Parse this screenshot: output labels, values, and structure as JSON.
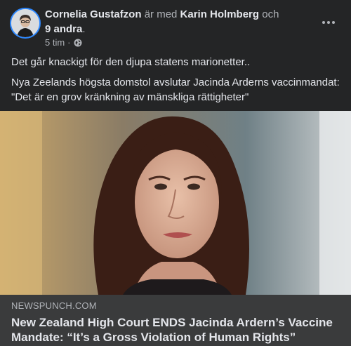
{
  "post": {
    "author": "Cornelia Gustafzon",
    "with_text": "är med",
    "tagged": "Karin Holmberg",
    "and_text": "och",
    "others": "9 andra",
    "period": ".",
    "time": "5 tim",
    "separator": "·",
    "privacy_icon": "globe-icon",
    "more_icon": "more-options-icon",
    "text_1": "Det går knackigt för den djupa statens marionetter..",
    "text_2": "Nya Zeelands högsta domstol avslutar Jacinda Arderns vaccinmandat: \"Det är en grov kränkning av mänskliga rättigheter\""
  },
  "link_preview": {
    "domain": "NEWSPUNCH.COM",
    "title": "New Zealand High Court ENDS Jacinda Ardern’s Vaccine Mandate: “It’s a Gross Violation of Human Rights”"
  },
  "colors": {
    "background": "#242526",
    "preview_background": "#3a3b3c",
    "primary_text": "#e4e6eb",
    "secondary_text": "#b0b3b8",
    "avatar_ring": "#2d88ff"
  }
}
